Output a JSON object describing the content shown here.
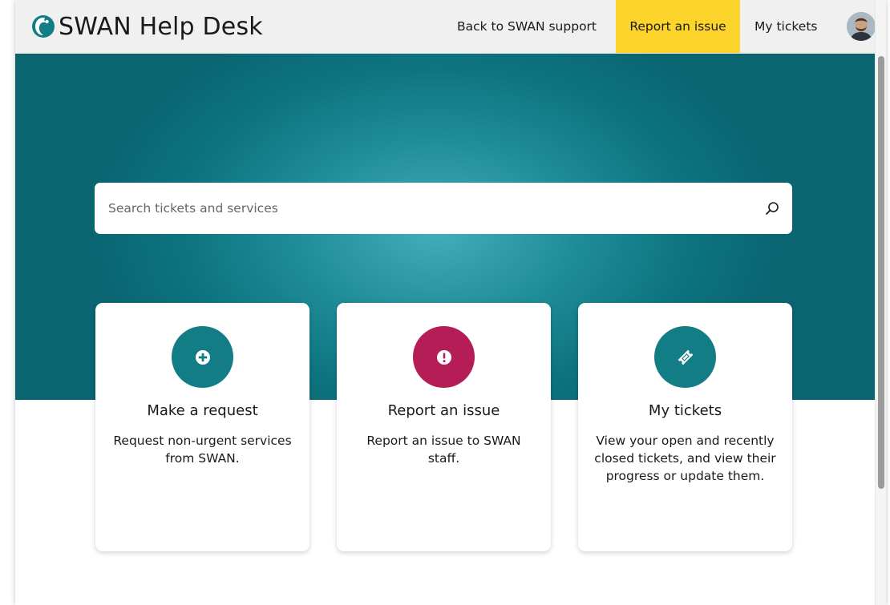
{
  "header": {
    "app_title": "SWAN Help Desk",
    "nav": {
      "back_label": "Back to SWAN support",
      "report_label": "Report an issue",
      "my_tickets_label": "My tickets"
    },
    "active_nav_color": "#fcd42b"
  },
  "search": {
    "placeholder": "Search tickets and services"
  },
  "cards": [
    {
      "title": "Make a request",
      "description": "Request non-urgent services from SWAN.",
      "icon": "plus-circle-icon",
      "color": "#137d85"
    },
    {
      "title": "Report an issue",
      "description": "Report an issue to SWAN staff.",
      "icon": "exclamation-circle-icon",
      "color": "#b41d56"
    },
    {
      "title": "My tickets",
      "description": "View your open and recently closed tickets, and view their progress or update them.",
      "icon": "ticket-icon",
      "color": "#137d85"
    }
  ],
  "colors": {
    "hero_teal": "#0d7580",
    "accent_yellow": "#fcd42b",
    "teal": "#137d85",
    "magenta": "#b41d56"
  }
}
